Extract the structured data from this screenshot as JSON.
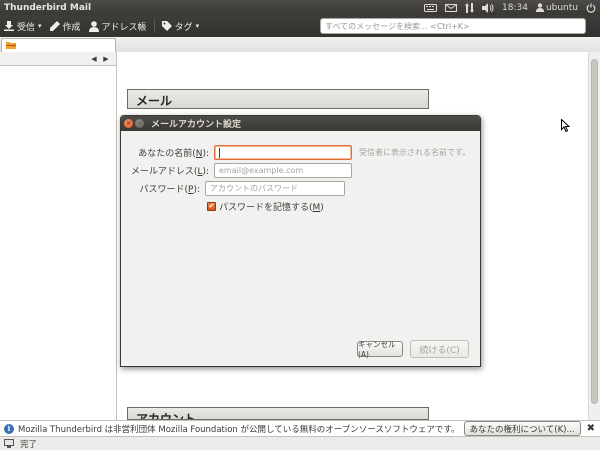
{
  "panel": {
    "app_title": "Thunderbird Mail",
    "clock": "18:34",
    "user": "ubuntu",
    "tray_icons": [
      "keyboard-icon",
      "mail-indicator-icon",
      "network-icon",
      "volume-icon",
      "user-icon"
    ]
  },
  "toolbar": {
    "receive_label": "受信",
    "compose_label": "作成",
    "address_book_label": "アドレス帳",
    "tag_label": "タグ",
    "search_placeholder": "すべてのメッセージを検索... <Ctrl+K>"
  },
  "content": {
    "mail_section_title": "メール",
    "account_section_title": "アカウント"
  },
  "dialog": {
    "title": "メールアカウント設定",
    "name_label": "あなたの名前(",
    "name_accesskey": "N",
    "name_label_end": "):",
    "name_hint": "受信者に表示される名前です。",
    "email_label": "メールアドレス(",
    "email_accesskey": "L",
    "email_label_end": "):",
    "email_placeholder": "email@example.com",
    "password_label": "パスワード(",
    "password_accesskey": "P",
    "password_label_end": "):",
    "password_placeholder": "アカウントのパスワード",
    "remember_label": "パスワードを記憶する(",
    "remember_accesskey": "M",
    "remember_label_end": ")",
    "remember_checked": true,
    "cancel_label": "キャンセル(A)",
    "continue_label": "続ける(C)"
  },
  "notification": {
    "text": "Mozilla Thunderbird は非営利団体 Mozilla Foundation が公開している無料のオープンソースソフトウェアです。",
    "rights_button": "あなたの権利について(K)...",
    "close_symbol": "✖"
  },
  "status": {
    "text": "完了"
  },
  "colors": {
    "accent": "#e06d37",
    "panel_bg": "#3c3b37",
    "window_bg": "#f2f1f0"
  }
}
